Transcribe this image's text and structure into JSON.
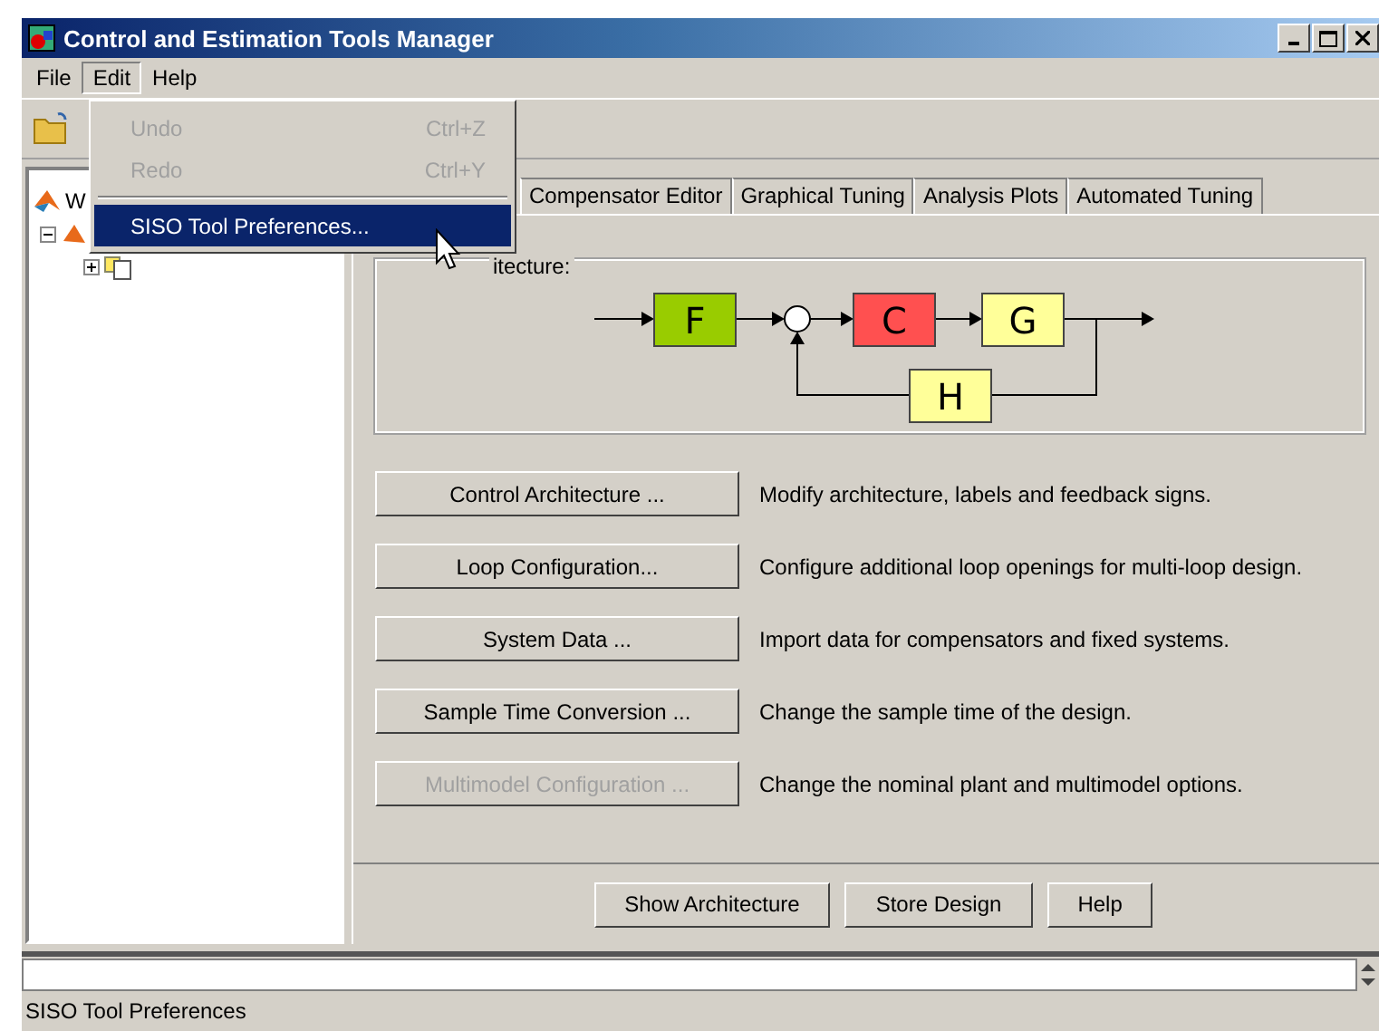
{
  "window": {
    "title": "Control and Estimation Tools Manager"
  },
  "menu_bar": [
    {
      "label": "File",
      "selected": false
    },
    {
      "label": "Edit",
      "selected": true
    },
    {
      "label": "Help",
      "selected": false
    }
  ],
  "edit_menu": [
    {
      "kind": "item",
      "label": "Undo",
      "shortcut": "Ctrl+Z",
      "disabled": true,
      "selected": false
    },
    {
      "kind": "item",
      "label": "Redo",
      "shortcut": "Ctrl+Y",
      "disabled": true,
      "selected": false
    },
    {
      "kind": "separator"
    },
    {
      "kind": "item",
      "label": "SISO Tool Preferences...",
      "disabled": false,
      "selected": true
    }
  ],
  "tree": [
    {
      "label": "W",
      "children": [
        {
          "expanded": true,
          "children": [
            {
              "expanded": false
            }
          ]
        }
      ]
    }
  ],
  "tabs": [
    {
      "label": "Compensator Editor",
      "selected": false
    },
    {
      "label": "Graphical Tuning",
      "selected": false
    },
    {
      "label": "Analysis Plots",
      "selected": false
    },
    {
      "label": "Automated Tuning",
      "selected": false
    }
  ],
  "architecture": {
    "title": "itecture:",
    "blocks": [
      {
        "label": "F",
        "color": "#99cc00"
      },
      {
        "label": "C",
        "color": "#ff5050"
      },
      {
        "label": "G",
        "color": "#ffff99"
      },
      {
        "label": "H",
        "color": "#ffff99"
      }
    ]
  },
  "actions": [
    {
      "button": "Control Architecture ...",
      "description": "Modify architecture, labels and feedback signs.",
      "disabled": false
    },
    {
      "button": "Loop Configuration...",
      "description": "Configure additional loop openings for multi-loop design.",
      "disabled": false
    },
    {
      "button": "System Data ...",
      "description": "Import data for compensators and fixed systems.",
      "disabled": false
    },
    {
      "button": "Sample Time Conversion ...",
      "description": "Change the sample time of the design.",
      "disabled": false
    },
    {
      "button": "Multimodel Configuration ...",
      "description": "Change the nominal plant and multimodel options.",
      "disabled": true
    }
  ],
  "bottom_buttons": [
    "Show Architecture",
    "Store Design",
    "Help"
  ],
  "status_bar": "SISO Tool Preferences"
}
